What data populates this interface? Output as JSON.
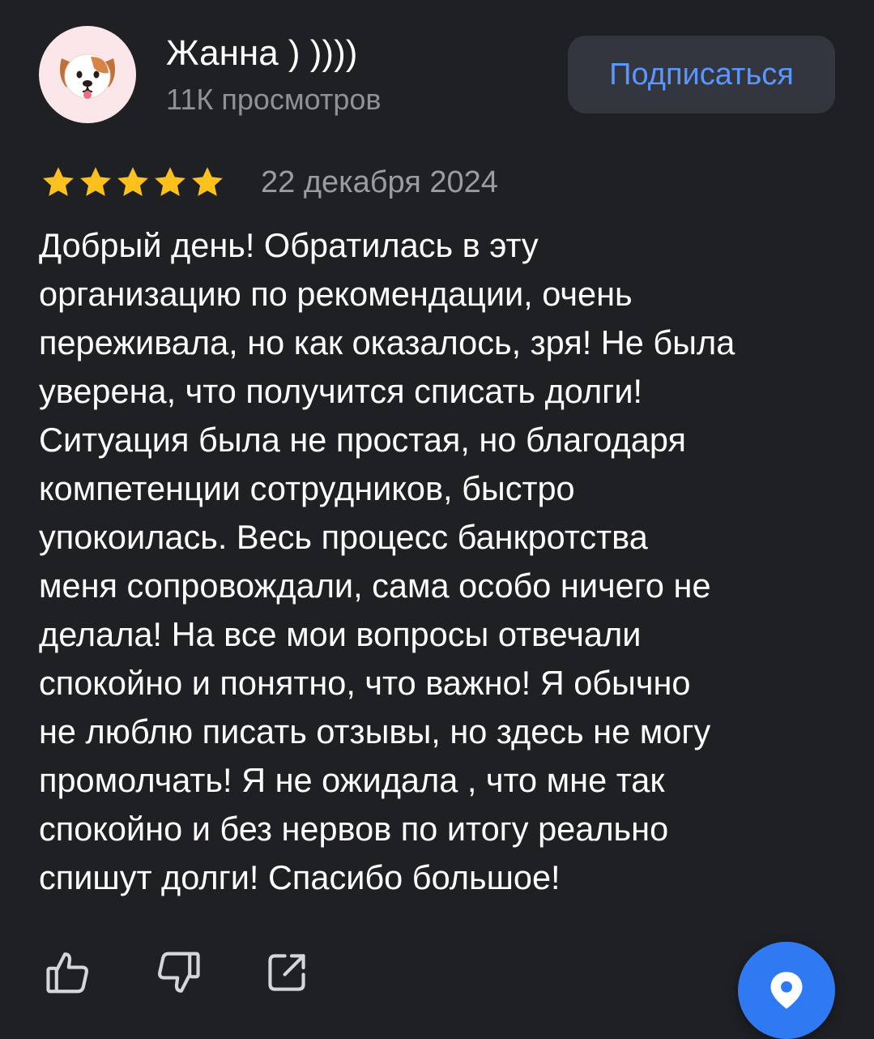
{
  "author": {
    "name": "Жанна ) ))))",
    "views": "11К просмотров",
    "avatar_icon": "dog-face-emoji-icon"
  },
  "subscribe": {
    "label": "Подписаться",
    "color": "#5b96ff"
  },
  "review": {
    "rating": 5,
    "max_rating": 5,
    "star_color": "#fcc11d",
    "date": "22 декабря 2024",
    "lines": [
      "Добрый день! Обратилась в эту",
      "организацию по рекомендации, очень",
      "переживала, но как оказалось, зря! Не была",
      "уверена, что получится списать долги!",
      "Ситуация была не простая, но благодаря",
      "компетенции сотрудников, быстро",
      "упокоилась. Весь процесс банкротства",
      "меня сопровождали, сама особо ничего не",
      "делала! На все мои вопросы отвечали",
      "спокойно и понятно, что важно! Я обычно",
      "не люблю писать отзывы, но здесь не могу",
      "промолчать! Я не ожидала , что мне так",
      "спокойно и без нервов по итогу реально",
      "спишут долги! Спасибо большое!"
    ]
  },
  "actions": {
    "like_icon": "thumbs-up-icon",
    "dislike_icon": "thumbs-down-icon",
    "share_icon": "share-icon"
  },
  "fab": {
    "icon": "map-pin-icon",
    "color": "#2f7af2"
  }
}
